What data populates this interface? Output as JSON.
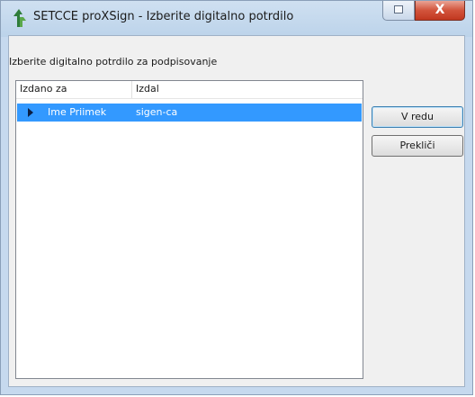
{
  "window": {
    "title": "SETCCE proXSign - Izberite digitalno potrdilo",
    "close_label": "X"
  },
  "dialog": {
    "instruction": "Izberite digitalno potrdilo za podpisovanje",
    "columns": [
      "Izdano za",
      "Izdal"
    ],
    "rows": [
      {
        "issued_to": "Ime Priimek",
        "issued_by": "sigen-ca",
        "selected": true
      }
    ],
    "buttons": {
      "ok": "V redu",
      "cancel": "Prekliči"
    }
  },
  "colors": {
    "selection": "#3399ff",
    "close_button": "#c1371f"
  }
}
